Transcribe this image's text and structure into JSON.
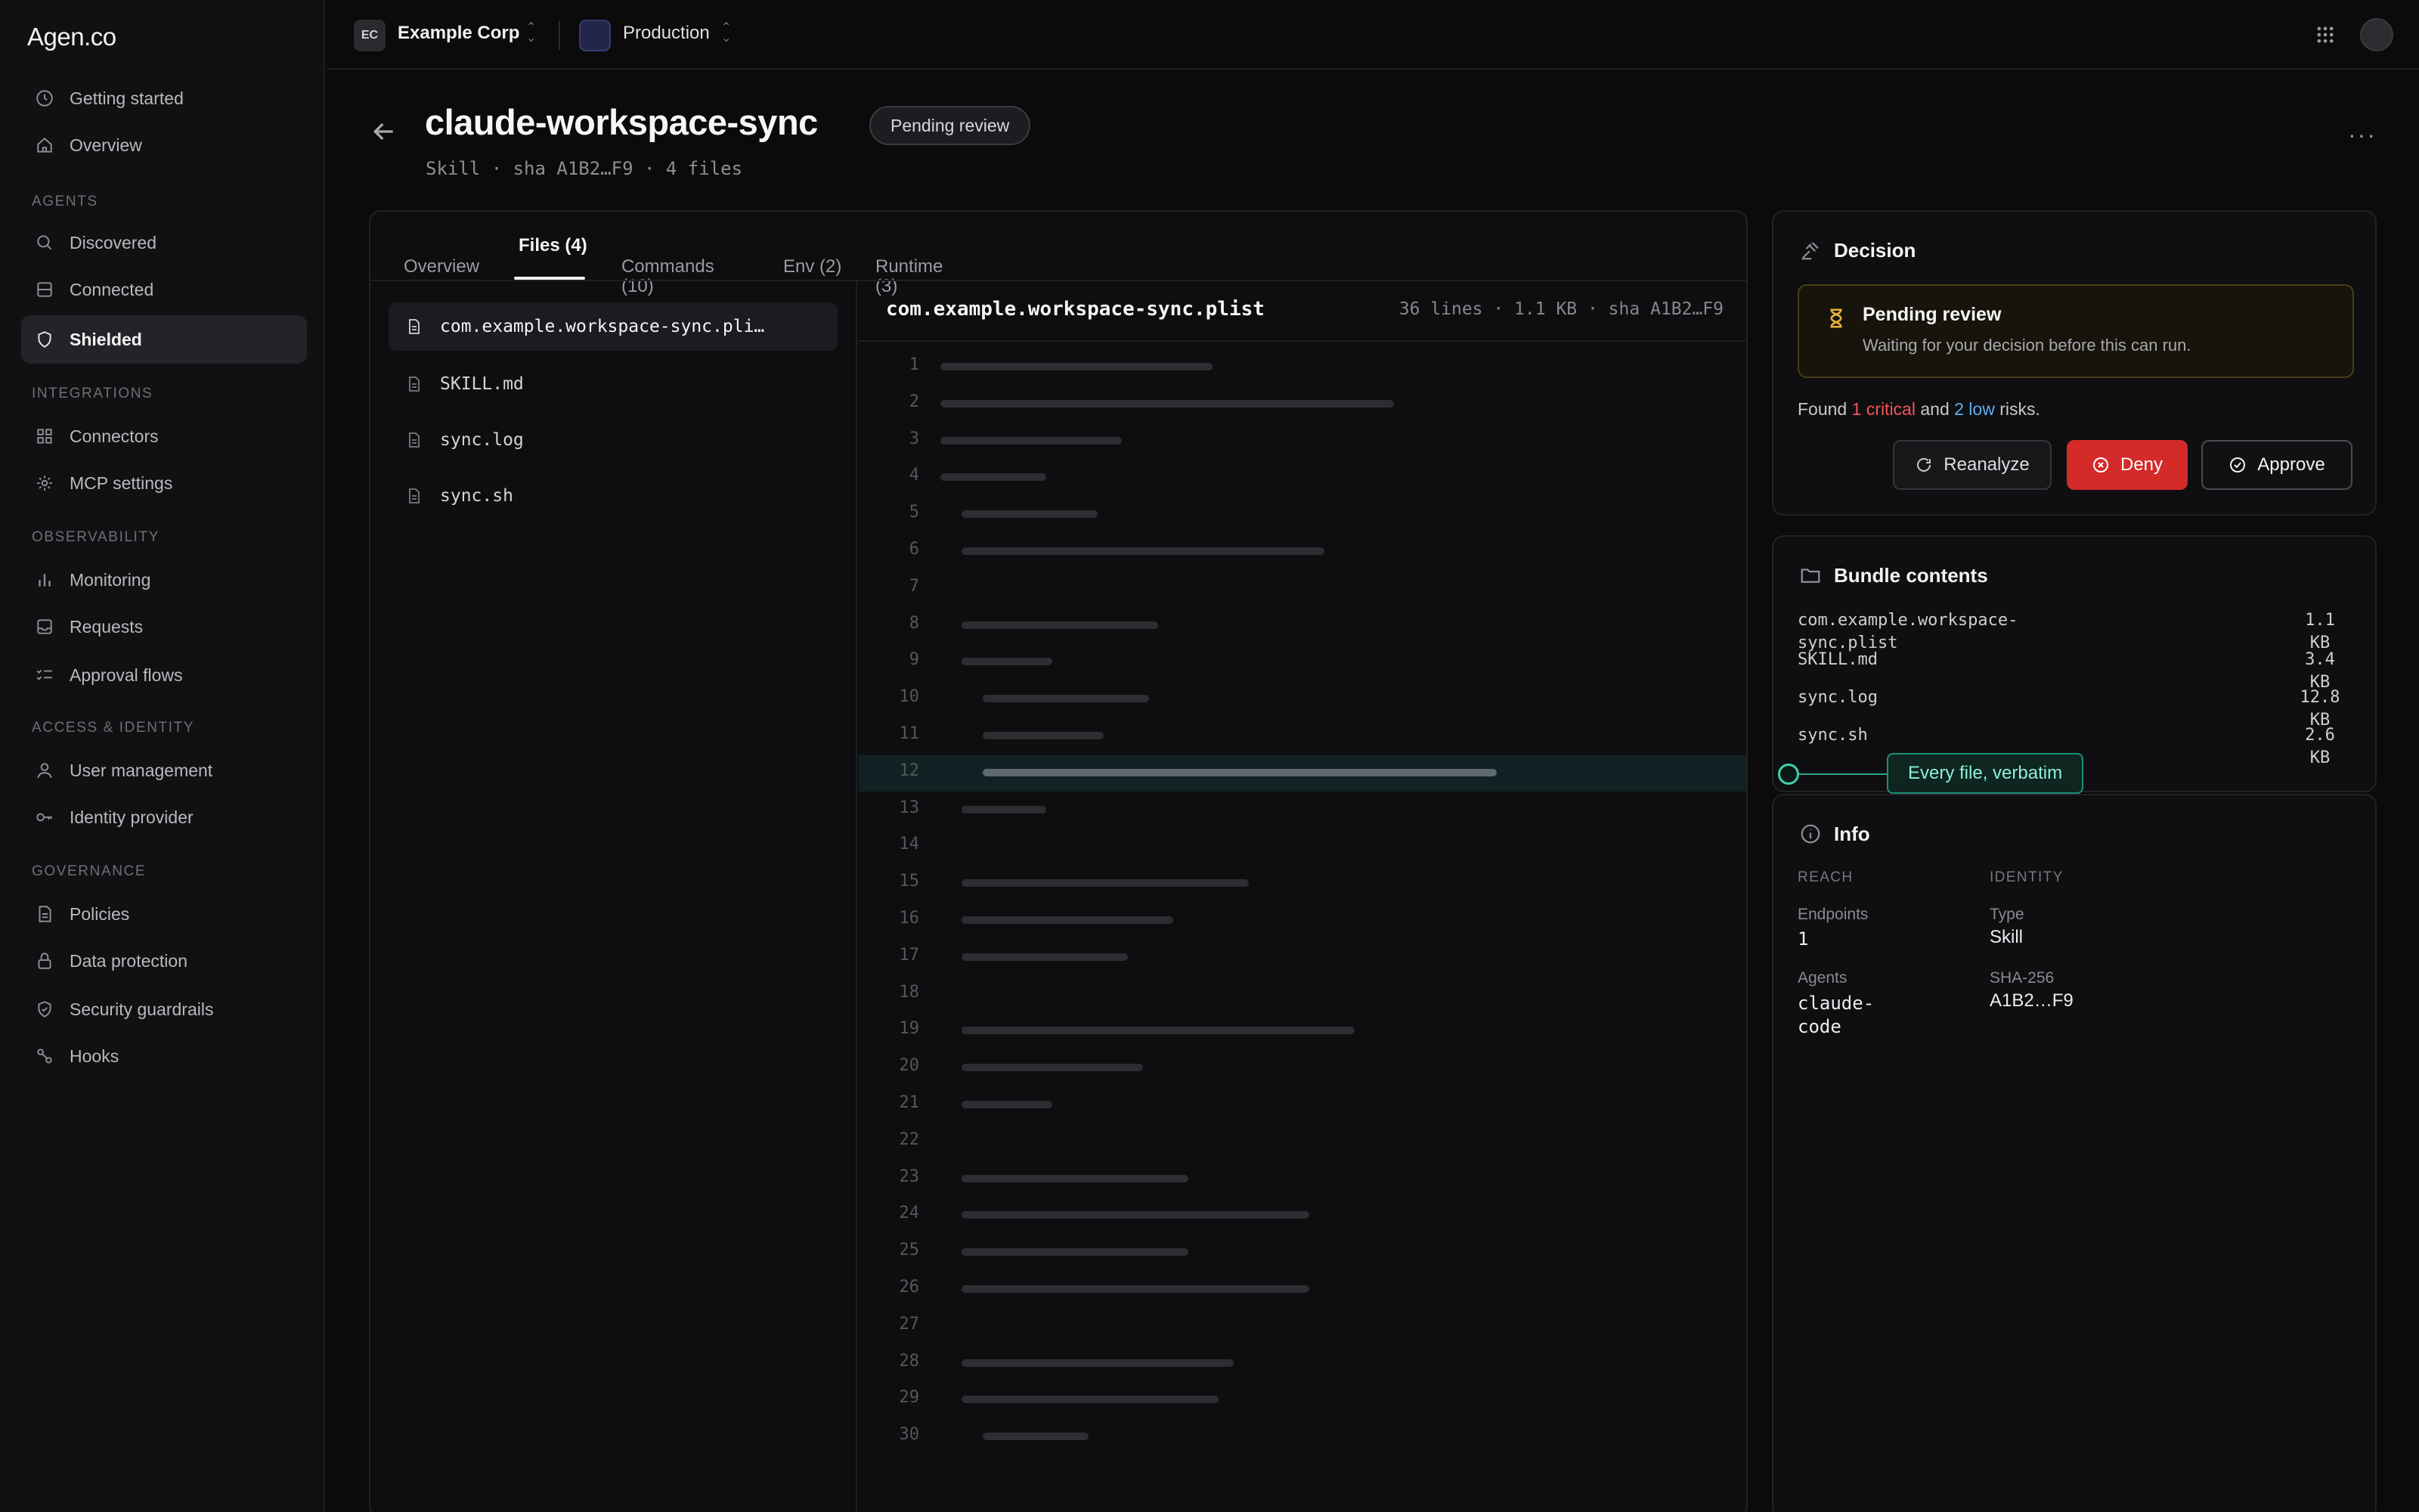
{
  "app": {
    "logo": "Agen.co"
  },
  "sidebar": {
    "top_items": [
      {
        "label": "Getting started"
      },
      {
        "label": "Overview"
      }
    ],
    "sections": {
      "agents": "AGENTS",
      "integrations": "INTEGRATIONS",
      "observability": "OBSERVABILITY",
      "access": "ACCESS & IDENTITY",
      "governance": "GOVERNANCE"
    },
    "agents": [
      {
        "label": "Discovered"
      },
      {
        "label": "Connected"
      },
      {
        "label": "Shielded"
      }
    ],
    "integrations": [
      {
        "label": "Connectors"
      },
      {
        "label": "MCP settings"
      }
    ],
    "observability": [
      {
        "label": "Monitoring"
      },
      {
        "label": "Requests"
      },
      {
        "label": "Approval flows"
      }
    ],
    "access": [
      {
        "label": "User management"
      },
      {
        "label": "Identity provider"
      }
    ],
    "governance": [
      {
        "label": "Policies"
      },
      {
        "label": "Data protection"
      },
      {
        "label": "Security guardrails"
      },
      {
        "label": "Hooks"
      }
    ]
  },
  "topbar": {
    "org_initials": "EC",
    "org_name": "Example Corp",
    "env_name": "Production"
  },
  "header": {
    "title": "claude-workspace-sync",
    "status": "Pending review",
    "subtitle": "Skill · sha A1B2…F9 · 4 files",
    "more": "···"
  },
  "tabs": [
    {
      "label": "Overview"
    },
    {
      "label": "Files (4)"
    },
    {
      "label": "Commands",
      "sub": "(10)"
    },
    {
      "label": "Env (2)"
    },
    {
      "label": "Runtime",
      "sub": "(3)"
    }
  ],
  "files": [
    {
      "name": "com.example.workspace-sync.pli…"
    },
    {
      "name": "SKILL.md"
    },
    {
      "name": "sync.log"
    },
    {
      "name": "sync.sh"
    }
  ],
  "viewer": {
    "filename": "com.example.workspace-sync.plist",
    "meta": "36 lines · 1.1 KB · sha A1B2…F9",
    "line_numbers": [
      "1",
      "2",
      "3",
      "4",
      "5",
      "6",
      "7",
      "8",
      "9",
      "10",
      "11",
      "12",
      "13",
      "14",
      "15",
      "16",
      "17",
      "18",
      "19",
      "20",
      "21",
      "22",
      "23",
      "24",
      "25",
      "26",
      "27",
      "28",
      "29",
      "30"
    ],
    "highlight_line": 12
  },
  "decision": {
    "title": "Decision",
    "pending_title": "Pending review",
    "pending_desc": "Waiting for your decision before this can run.",
    "found_prefix": "Found",
    "critical": "1 critical",
    "and": "and",
    "low": "2 low",
    "suffix": "risks.",
    "reanalyze": "Reanalyze",
    "deny": "Deny",
    "approve": "Approve"
  },
  "bundle": {
    "title": "Bundle contents",
    "items": [
      {
        "name": "com.example.workspace-\nsync.plist",
        "size": "1.1\nKB"
      },
      {
        "name": "SKILL.md",
        "size": "3.4\nKB"
      },
      {
        "name": "sync.log",
        "size": "12.8\nKB"
      },
      {
        "name": "sync.sh",
        "size": "2.6\nKB"
      }
    ],
    "callout": "Every file, verbatim"
  },
  "info": {
    "title": "Info",
    "reach_label": "REACH",
    "identity_label": "IDENTITY",
    "endpoints_k": "Endpoints",
    "endpoints_v": "1",
    "agents_k": "Agents",
    "agents_v": "claude-\ncode",
    "type_k": "Type",
    "type_v": "Skill",
    "sha_k": "SHA-256",
    "sha_v": "A1B2…F9"
  },
  "colors": {
    "critical": "#f2545b",
    "low": "#5ab0f2",
    "deny": "#d42a2a",
    "callout": "#3ed1ad"
  }
}
